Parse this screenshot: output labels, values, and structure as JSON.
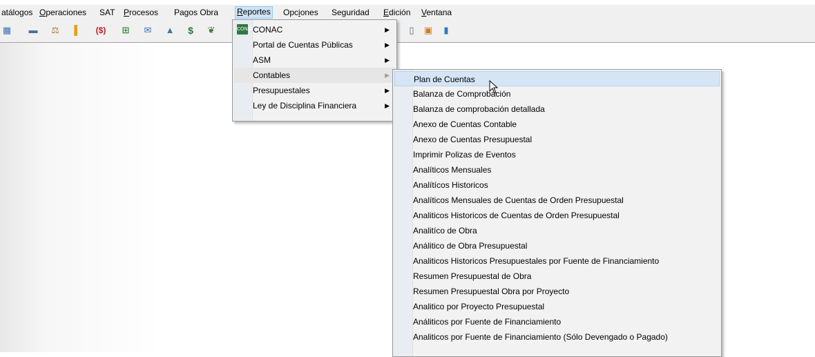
{
  "menubar": {
    "items": [
      {
        "label": "atálogos",
        "mnem": "",
        "rest": ""
      },
      {
        "label": "",
        "mnem": "O",
        "rest": "peraciones"
      },
      {
        "label": "SAT",
        "mnem": "",
        "rest": ""
      },
      {
        "label": "",
        "mnem": "P",
        "rest": "rocesos"
      },
      {
        "label": "Pagos Obra",
        "mnem": "",
        "rest": ""
      },
      {
        "label": "",
        "mnem": "R",
        "rest": "eportes"
      },
      {
        "label": "Opc",
        "mnem": "i",
        "rest": "ones"
      },
      {
        "label": "Seguridad",
        "mnem": "",
        "rest": ""
      },
      {
        "label": "",
        "mnem": "E",
        "rest": "dición"
      },
      {
        "label": "",
        "mnem": "V",
        "rest": "entana"
      }
    ]
  },
  "toolbar": {
    "icons": [
      {
        "name": "grid-icon",
        "glyph": "▦",
        "color": "#3a6fb5"
      },
      {
        "name": "calculator-icon",
        "glyph": "▬",
        "color": "#4a6fa0"
      },
      {
        "name": "scale-icon",
        "glyph": "⚖",
        "color": "#b07a2a"
      },
      {
        "name": "bar-chart-icon",
        "glyph": "▌",
        "color": "#e0a020"
      },
      {
        "name": "money-icon",
        "glyph": "($)",
        "color": "#c0202a"
      },
      {
        "name": "building-icon",
        "glyph": "⊞",
        "color": "#3a8a3a"
      },
      {
        "name": "envelope-chart-icon",
        "glyph": "✉",
        "color": "#3a6fb5"
      },
      {
        "name": "document-icon",
        "glyph": "▲",
        "color": "#3a7a9a"
      },
      {
        "name": "dollar-icon",
        "glyph": "$",
        "color": "#2a7a3a"
      },
      {
        "name": "leaf-icon",
        "glyph": "❦",
        "color": "#3a7a3a"
      }
    ],
    "right_icons": [
      {
        "name": "notebook-icon",
        "glyph": "▯",
        "color": "#5a6a7a"
      },
      {
        "name": "colorful-box-icon",
        "glyph": "▣",
        "color": "#d07a20"
      },
      {
        "name": "plug-icon",
        "glyph": "▮",
        "color": "#2a7ac0"
      }
    ]
  },
  "reportes_menu": {
    "items": [
      {
        "label": "CONAC",
        "icon": "CONAC"
      },
      {
        "label": "Portal de Cuentas Públicas"
      },
      {
        "label": "ASM"
      },
      {
        "label": "Contables"
      },
      {
        "label": "Presupuestales"
      },
      {
        "label": "Ley de Disciplina Financiera"
      }
    ]
  },
  "contables_menu": {
    "items": [
      "Plan de Cuentas",
      "Balanza de Comprobación",
      "Balanza de comprobación detallada",
      "Anexo de Cuentas Contable",
      "Anexo de Cuentas Presupuestal",
      "Imprimir Polizas de Eventos",
      "Analíticos Mensuales",
      "Analítícos Historicos",
      "Analíticos Mensuales de Cuentas de Orden Presupuestal",
      "Analiticos Historicos de Cuentas de Orden Presupuestal",
      "Analitíco de Obra",
      "Análitico de Obra Presupuestal",
      "Analiticos Historicos Presupuestales por Fuente de Financiamiento",
      "Resumen Presupuestal de Obra",
      "Resumen Presupuestal Obra por Proyecto",
      "Analitico por Proyecto Presupuestal",
      "Análiticos por Fuente de Financiamiento",
      "Analiticos por Fuente de Financiamiento (Sólo Devengado o Pagado)"
    ]
  }
}
